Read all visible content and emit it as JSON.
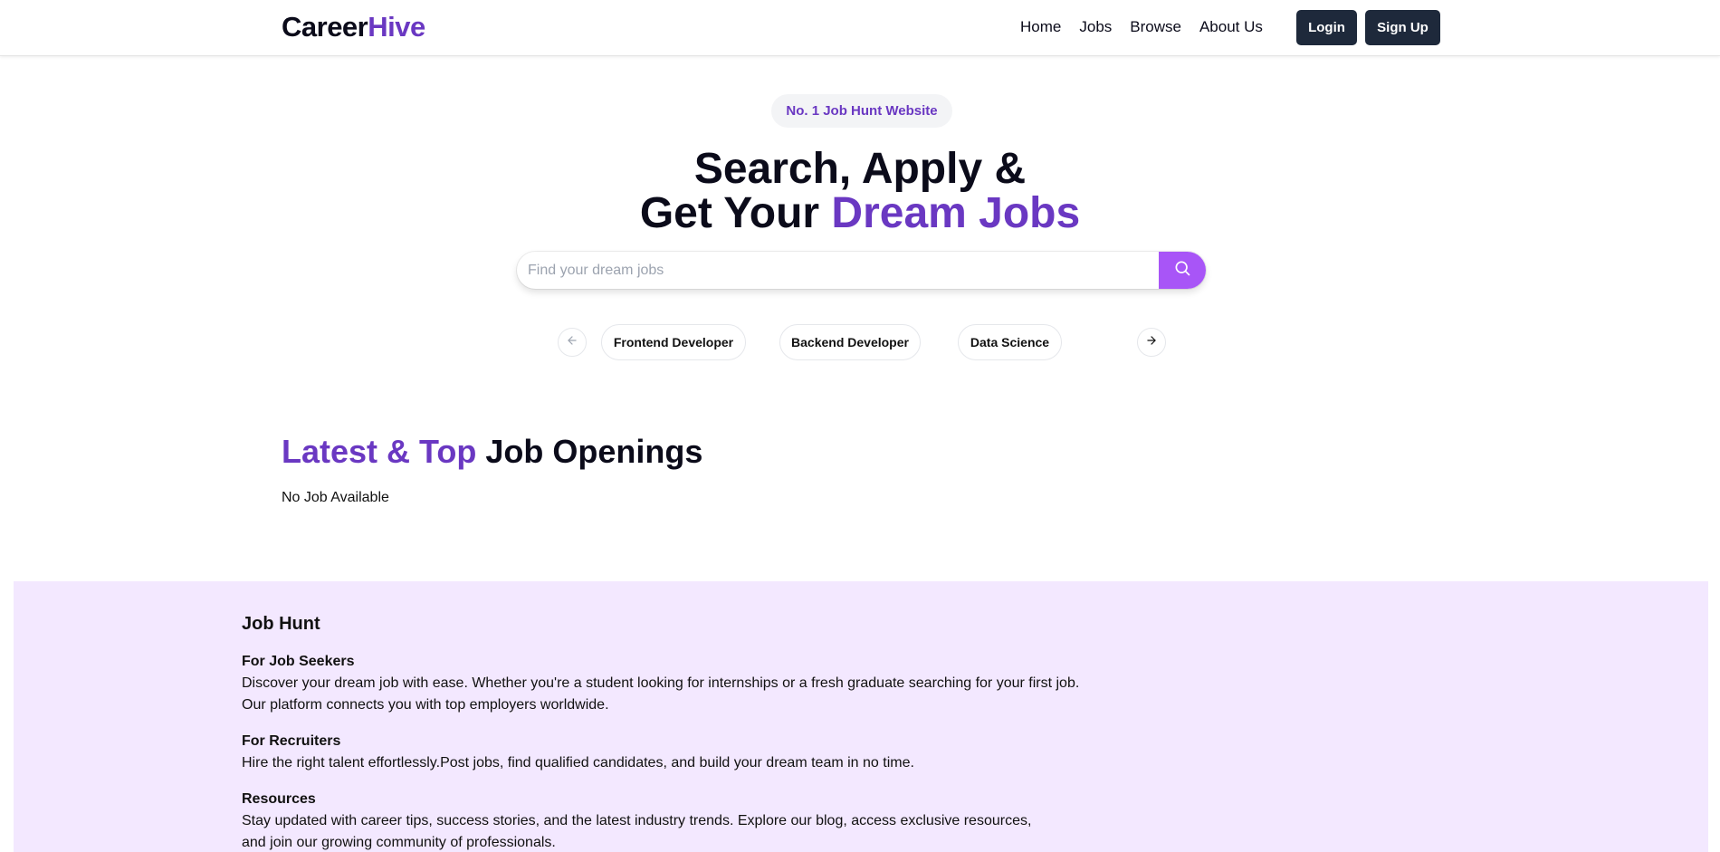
{
  "header": {
    "logo_part1": "Career",
    "logo_part2": "Hive",
    "nav": [
      "Home",
      "Jobs",
      "Browse",
      "About Us"
    ],
    "login_label": "Login",
    "signup_label": "Sign Up"
  },
  "hero": {
    "badge": "No. 1 Job Hunt Website",
    "title_line1": "Search, Apply &",
    "title_line2_plain": "Get Your ",
    "title_line2_accent": "Dream Jobs",
    "search_placeholder": "Find your dream jobs",
    "categories": [
      "Frontend Developer",
      "Backend Developer",
      "Data Science"
    ]
  },
  "latest": {
    "title_accent": "Latest & Top",
    "title_plain": " Job Openings",
    "empty_text": "No Job Available"
  },
  "footer": {
    "title": "Job Hunt",
    "sections": [
      {
        "heading": "For Job Seekers",
        "lines": [
          "Discover your dream job with ease. Whether you're a student looking for internships or a fresh graduate searching for your first job.",
          "Our platform connects you with top employers worldwide."
        ]
      },
      {
        "heading": "For Recruiters",
        "lines": [
          "Hire the right talent effortlessly.Post jobs, find qualified candidates, and build your dream team in no time."
        ]
      },
      {
        "heading": "Resources",
        "lines": [
          "Stay updated with career tips, success stories, and the latest industry trends. Explore our blog, access exclusive resources,",
          "and join our growing community of professionals."
        ]
      }
    ]
  },
  "colors": {
    "brand": "#6a38c2",
    "search_button": "#a855f7",
    "dark_button": "#1e293b",
    "footer_bg": "#f3e8ff"
  },
  "icons": {
    "search": "search-icon",
    "prev": "arrow-left-icon",
    "next": "arrow-right-icon"
  }
}
